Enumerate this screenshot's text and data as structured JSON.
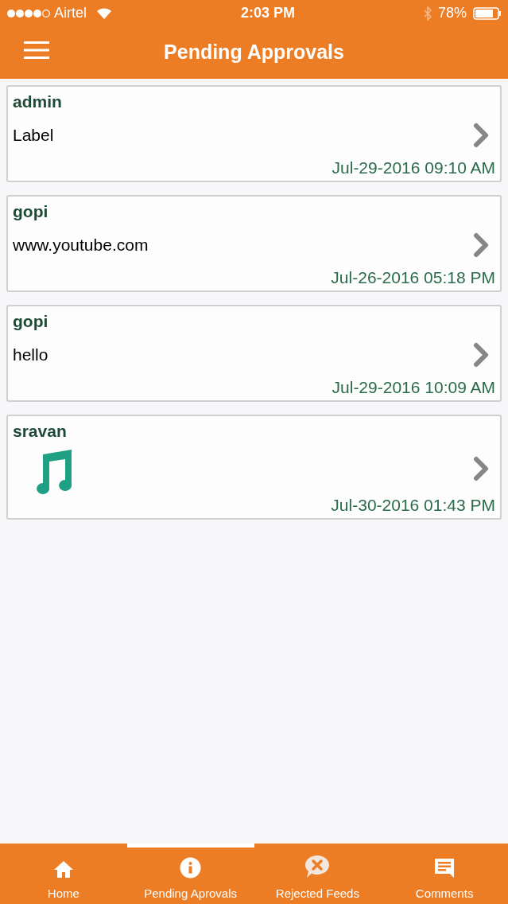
{
  "status_bar": {
    "carrier": "Airtel",
    "time": "2:03 PM",
    "battery": "78%"
  },
  "header": {
    "title": "Pending Approvals"
  },
  "feeds": [
    {
      "kind": "text",
      "author": "admin",
      "content": "Label",
      "date": "Jul-29-2016 09:10 AM"
    },
    {
      "kind": "text",
      "author": "gopi",
      "content": "www.youtube.com",
      "date": "Jul-26-2016 05:18 PM"
    },
    {
      "kind": "text",
      "author": "gopi",
      "content": "hello",
      "date": "Jul-29-2016 10:09 AM"
    },
    {
      "kind": "audio",
      "author": "sravan",
      "date": "Jul-30-2016 01:43 PM"
    }
  ],
  "tabs": [
    {
      "label": "Home",
      "kind": "home",
      "selected": false
    },
    {
      "label": "Pending Aprovals",
      "kind": "info",
      "selected": true
    },
    {
      "label": "Rejected Feeds",
      "kind": "rejected",
      "selected": false
    },
    {
      "label": "Comments",
      "kind": "comments",
      "selected": false
    }
  ]
}
